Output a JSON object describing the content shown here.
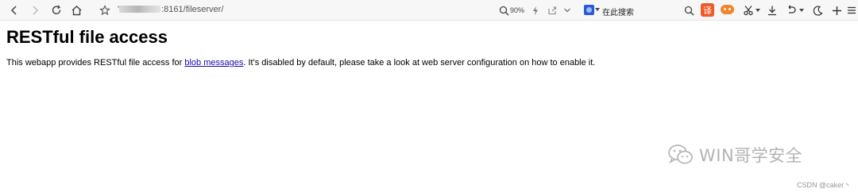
{
  "toolbar": {
    "url_prefix": "'",
    "url_text": ":8161/fileserver/",
    "zoom": "90%",
    "search_placeholder": "在此搜索",
    "translate_label": "译",
    "icons": [
      "back-icon",
      "forward-icon",
      "reload-icon",
      "home-icon",
      "star-icon",
      "zoom-icon",
      "lightning-icon",
      "share-icon",
      "chevron-down-icon",
      "search-engine-icon",
      "magnifier-icon",
      "translate-icon",
      "game-icon",
      "scissors-icon",
      "download-icon",
      "undo-icon",
      "moon-icon",
      "plus-icon",
      "menu-icon"
    ]
  },
  "page": {
    "title": "RESTful file access",
    "text_before": "This webapp provides RESTful file access for ",
    "link_text": "blob messages",
    "text_after": ". It's disabled by default, please take a look at web server configuration on how to enable it."
  },
  "overlay": {
    "watermark": "WIN哥学安全",
    "csdn": "CSDN @caker丶"
  },
  "colors": {
    "link": "#1a0dab",
    "translate": "#f05a28",
    "game": "#f2852c",
    "search_engine": "#2a5bd7"
  }
}
